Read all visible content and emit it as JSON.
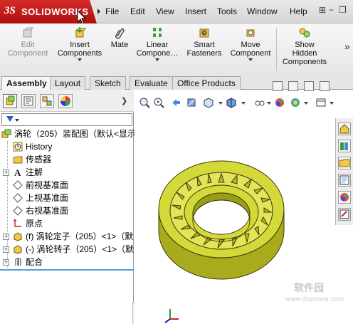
{
  "app": {
    "logo_ds": "3S",
    "logo_name": "SOLIDWORKS"
  },
  "menu": [
    "File",
    "Edit",
    "View",
    "Insert",
    "Tools",
    "Window",
    "Help"
  ],
  "commands": {
    "edit_component": "Edit\nComponent",
    "insert_components": "Insert\nComponents",
    "mate": "Mate",
    "linear_component": "Linear\nCompone…",
    "smart_fasteners": "Smart\nFasteners",
    "move_component": "Move\nComponent",
    "show_hidden": "Show\nHidden\nComponents"
  },
  "tabs": [
    "Assembly",
    "Layout",
    "Sketch",
    "Evaluate",
    "Office Products"
  ],
  "tree": {
    "root": "涡轮（205）装配图（默认<显示",
    "items": [
      "History",
      "传感器",
      "注解",
      "前视基准面",
      "上视基准面",
      "右视基准面",
      "原点",
      "(f) 涡轮定子（205）<1>（默",
      "(-) 涡轮转子（205）<1>（默",
      "配合"
    ]
  },
  "watermark": {
    "text": "软件园",
    "url": "www.downxia.com"
  },
  "colors": {
    "logo_red": "#c41e1e",
    "model_yellow": "#d4d93a",
    "selection_blue": "#4aa3df"
  }
}
